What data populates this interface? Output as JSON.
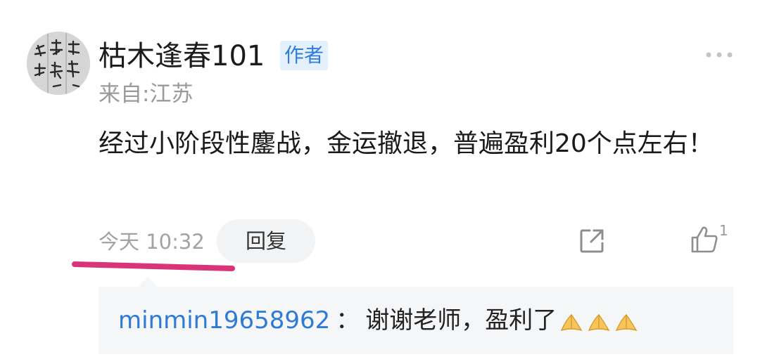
{
  "author": {
    "name": "枯木逢春101",
    "tag": "作者",
    "location": "来自:江苏"
  },
  "post": {
    "text": "经过小阶段性鏖战，金运撤退，普遍盈利20个点左右！",
    "time": "今天 10:32",
    "reply_label": "回复",
    "like_count": "1"
  },
  "icons": {
    "more": "more-dots-icon",
    "share": "share-icon",
    "like": "thumbs-up-icon",
    "emoji": "folded-hands-emoji"
  },
  "reply": {
    "user": "minmin19658962",
    "separator": "：",
    "text": "谢谢老师，盈利了"
  },
  "colors": {
    "accent": "#2e7bd6",
    "tag_bg": "#e4f1fd",
    "highlight_mark": "#d9347a"
  }
}
